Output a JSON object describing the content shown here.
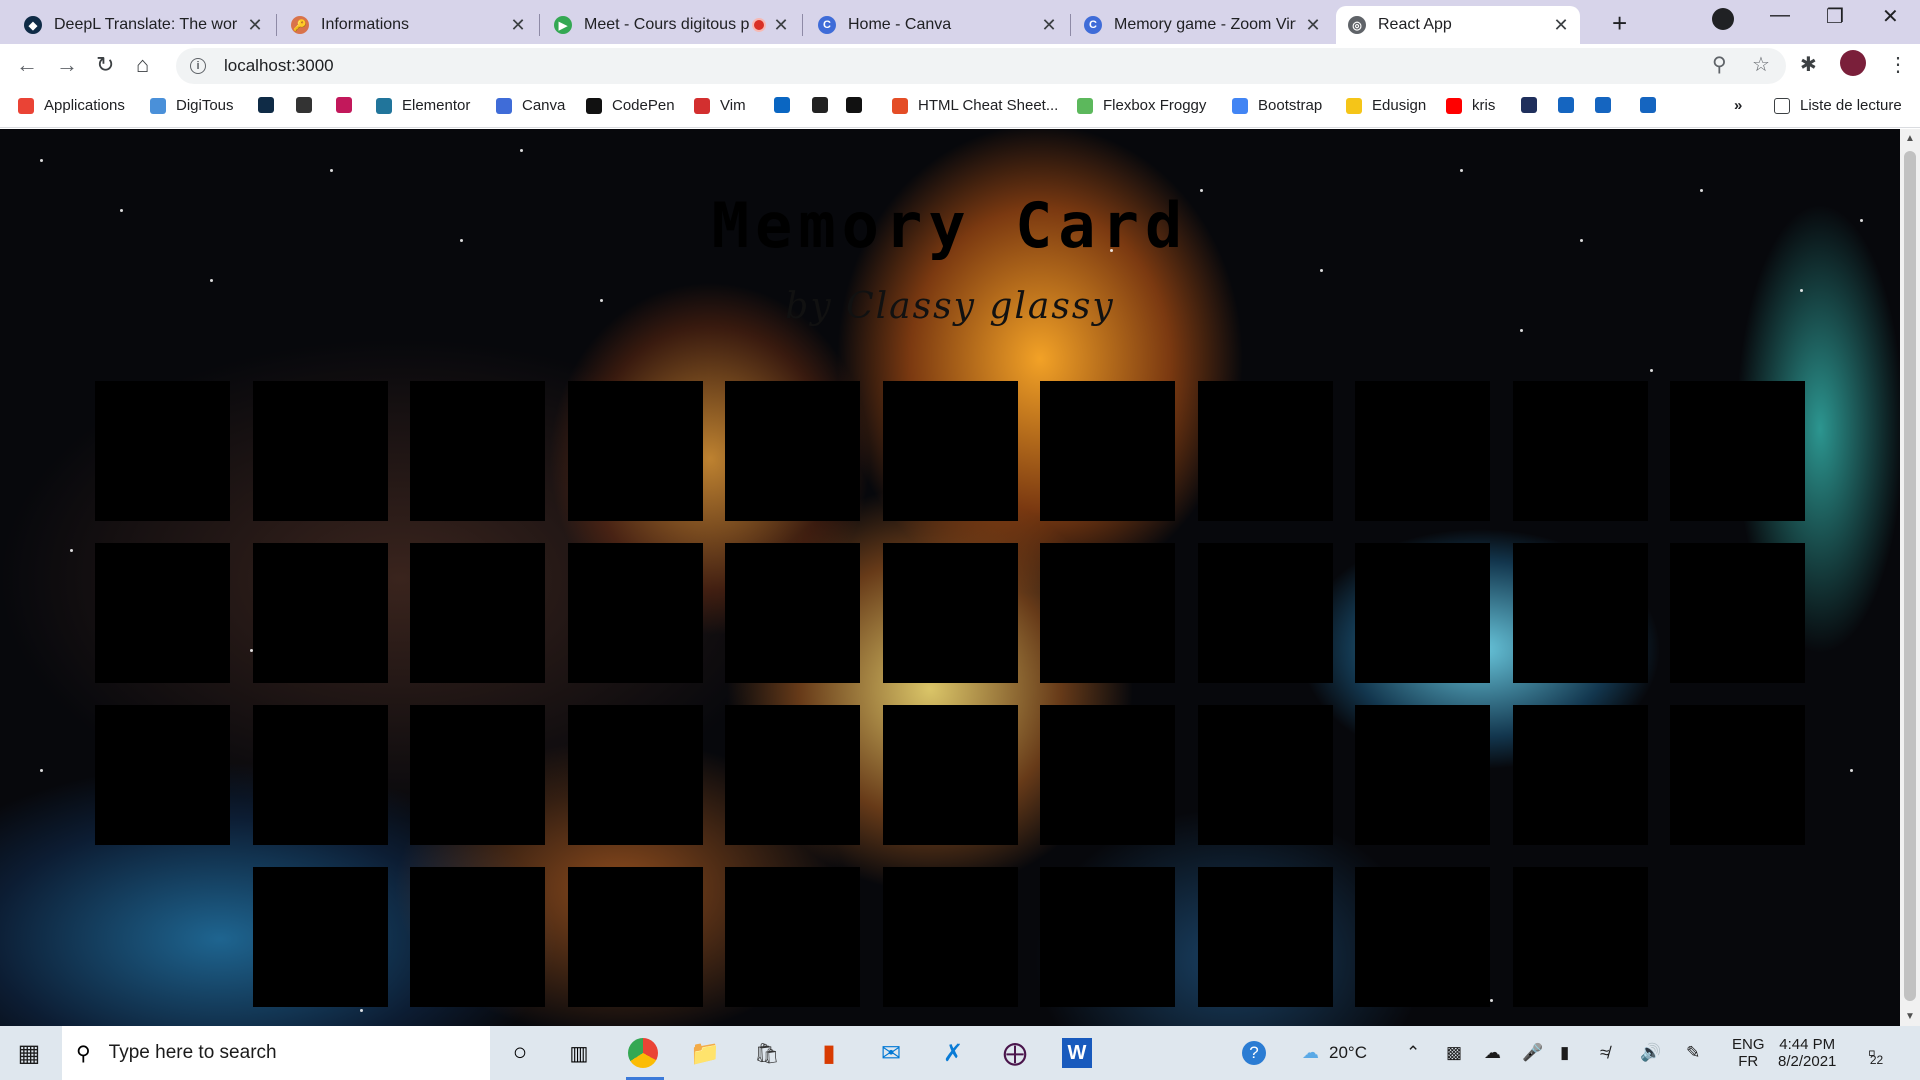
{
  "browser": {
    "tabs": [
      {
        "title": "DeepL Translate: The world'",
        "favicon_color": "#0f2b46",
        "favicon_glyph": "◆",
        "active": false
      },
      {
        "title": "Informations",
        "favicon_color": "#d9734a",
        "favicon_glyph": "🔑",
        "active": false
      },
      {
        "title": "Meet - Cours digitous p",
        "favicon_color": "#34a853",
        "favicon_glyph": "▶",
        "active": false,
        "recording": true
      },
      {
        "title": "Home - Canva",
        "favicon_color": "#3f6cd8",
        "favicon_glyph": "C",
        "active": false
      },
      {
        "title": "Memory game - Zoom Virtu",
        "favicon_color": "#3f6cd8",
        "favicon_glyph": "C",
        "active": false
      },
      {
        "title": "React App",
        "favicon_color": "#5f6368",
        "favicon_glyph": "◎",
        "active": true
      }
    ],
    "new_tab_label": "+",
    "url": "localhost:3000",
    "bookmarks": [
      {
        "label": "Applications",
        "color": "#ea4335"
      },
      {
        "label": "DigiTous",
        "color": "#4a90d9"
      },
      {
        "label": "",
        "color": "#0f2b46"
      },
      {
        "label": "",
        "color": "#333333"
      },
      {
        "label": "",
        "color": "#c2185b"
      },
      {
        "label": "Elementor",
        "color": "#21759b"
      },
      {
        "label": "Canva",
        "color": "#3f6cd8"
      },
      {
        "label": "CodePen",
        "color": "#111111"
      },
      {
        "label": "Vim",
        "color": "#d32f2f"
      },
      {
        "label": "",
        "color": "#0a66c2"
      },
      {
        "label": "",
        "color": "#222222"
      },
      {
        "label": "",
        "color": "#111111"
      },
      {
        "label": "HTML Cheat Sheet...",
        "color": "#e44d26"
      },
      {
        "label": "Flexbox Froggy",
        "color": "#5cb85c"
      },
      {
        "label": "Bootstrap",
        "color": "#4285f4"
      },
      {
        "label": "Edusign",
        "color": "#f5c518"
      },
      {
        "label": "kris",
        "color": "#ff0000"
      },
      {
        "label": "",
        "color": "#1f2f5c"
      },
      {
        "label": "",
        "color": "#1565c0"
      },
      {
        "label": "",
        "color": "#1565c0"
      },
      {
        "label": "",
        "color": "#1565c0"
      }
    ],
    "bookmarks_more": "»",
    "reading_list_label": "Liste de lecture"
  },
  "page": {
    "title": "Memory Card",
    "subtitle": "by Classy glassy",
    "card_rows": [
      11,
      11,
      11,
      9
    ],
    "card_color": "#000000"
  },
  "taskbar": {
    "search_placeholder": "Type here to search",
    "weather": "20°C",
    "language": "ENG",
    "keyboard": "FR",
    "time": "4:44 PM",
    "date": "8/2/2021",
    "notification_count": "22"
  }
}
